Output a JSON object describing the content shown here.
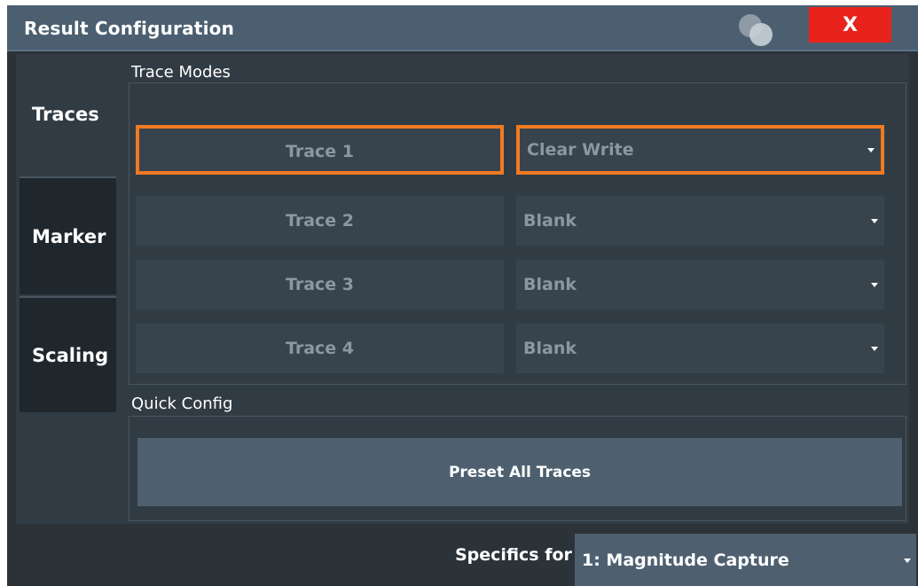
{
  "dialog": {
    "title": "Result Configuration",
    "close_label": "X"
  },
  "tabs": [
    {
      "label": "Traces",
      "active": true
    },
    {
      "label": "Marker",
      "active": false
    },
    {
      "label": "Scaling",
      "active": false
    }
  ],
  "trace_modes": {
    "group_label": "Trace Modes",
    "rows": [
      {
        "trace": "Trace 1",
        "mode": "Clear Write",
        "selected": true
      },
      {
        "trace": "Trace 2",
        "mode": "Blank",
        "selected": false
      },
      {
        "trace": "Trace 3",
        "mode": "Blank",
        "selected": false
      },
      {
        "trace": "Trace 4",
        "mode": "Blank",
        "selected": false
      }
    ]
  },
  "quick_config": {
    "group_label": "Quick Config",
    "preset_label": "Preset All Traces"
  },
  "footer": {
    "specifics_label": "Specifics for",
    "specifics_value": "1: Magnitude Capture"
  },
  "colors": {
    "titlebar": "#4b5f70",
    "close": "#e8231c",
    "selection": "#f07a22",
    "background": "#2b3339"
  }
}
